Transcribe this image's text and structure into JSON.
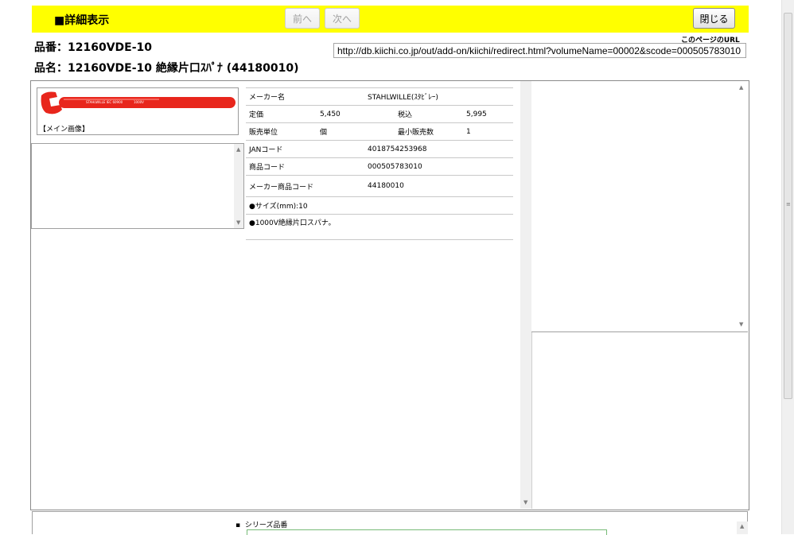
{
  "header": {
    "title": "■詳細表示",
    "prev_label": "前へ",
    "next_label": "次へ",
    "close_label": "閉じる"
  },
  "product": {
    "hinban_line": "品番：12160VDE-10",
    "hinmei_line": "品名：12160VDE-10 絶縁片口ｽﾊﾟﾅ (44180010)"
  },
  "url": {
    "label": "このページのURL",
    "value": "http://db.kiichi.co.jp/out/add-on/kiichi/redirect.html?volumeName=00002&scode=000505783010"
  },
  "image": {
    "caption": "【メイン画像】"
  },
  "spec": {
    "maker_label": "メーカー名",
    "maker_value": "STAHLWILLE(ｽﾀﾋﾞﾚｰ)",
    "price_label": "定価",
    "price_value": "5,450",
    "taxin_label": "税込",
    "taxin_value": "5,995",
    "unit_label": "販売単位",
    "unit_value": "個",
    "minqty_label": "最小販売数",
    "minqty_value": "1",
    "jan_label": "JANコード",
    "jan_value": "4018754253968",
    "code_label": "商品コード",
    "code_value": "000505783010",
    "makercode_label": "メーカー商品コード",
    "makercode_value": "44180010",
    "feature_size": "●サイズ(mm):10",
    "feature_desc": "●1000V絶縁片口スパナ。"
  },
  "series": {
    "label": "シリーズ品番"
  },
  "colors": {
    "topbar": "#ffff00",
    "wrench": "#e8261c"
  }
}
